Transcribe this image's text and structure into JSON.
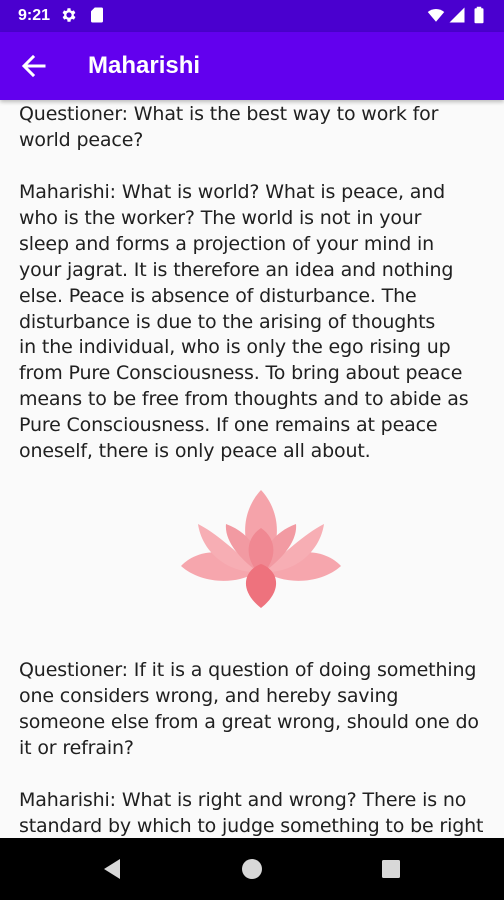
{
  "status_bar": {
    "time": "9:21",
    "icons": [
      "gear-icon",
      "sd-card-icon",
      "wifi-icon",
      "cellular-signal-icon",
      "battery-icon"
    ]
  },
  "app_bar": {
    "title": "Maharishi",
    "back_icon": "arrow-left-icon",
    "color": "#6200ee"
  },
  "content": {
    "paragraphs": [
      "Questioner: What is the best way to work for\nworld peace?",
      "Maharishi: What is world? What is peace, and\nwho is the worker? The world is not in your\nsleep and forms a projection of your mind in\nyour jagrat. It is therefore an idea and nothing\nelse. Peace is absence of disturbance. The\ndisturbance is due to the arising of thoughts\nin the individual, who is only the ego rising up\nfrom Pure Consciousness. To bring about peace\nmeans to be free from thoughts and to abide as\nPure Consciousness. If one remains at peace\noneself, there is only peace all about.",
      "Questioner: If it is a question of doing something\none considers wrong, and hereby saving\nsomeone else from a great wrong, should one do\nit or refrain?",
      "Maharishi: What is right and wrong? There is no\nstandard by which to judge something to be right"
    ],
    "divider_image": "lotus-flower-icon",
    "lotus_colors": [
      "#f6a6ad",
      "#f28b94",
      "#ee727d"
    ]
  },
  "nav_bar": {
    "buttons": [
      "back-triangle-icon",
      "home-circle-icon",
      "recents-square-icon"
    ]
  }
}
